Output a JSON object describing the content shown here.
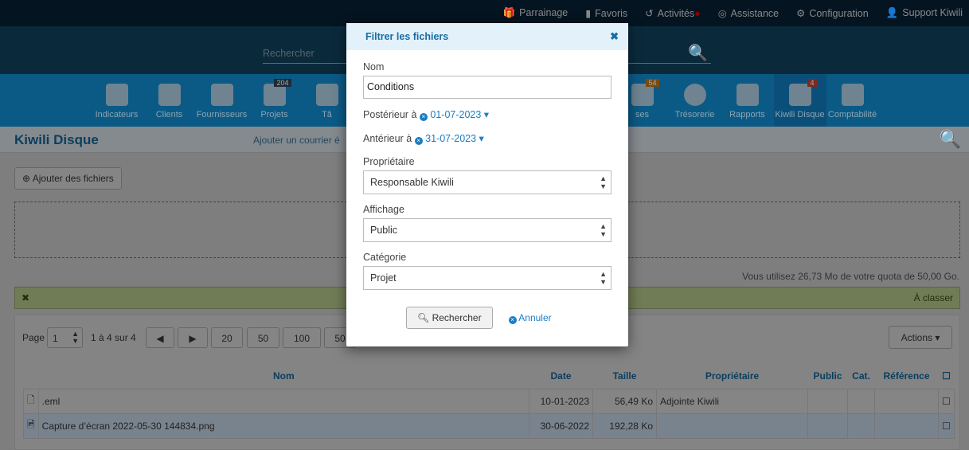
{
  "topbar": {
    "items": [
      "Parrainage",
      "Favoris",
      "Activités",
      "Assistance",
      "Configuration",
      "Support Kiwili"
    ]
  },
  "search": {
    "placeholder": "Rechercher"
  },
  "nav": {
    "items": [
      {
        "label": "Indicateurs"
      },
      {
        "label": "Clients"
      },
      {
        "label": "Fournisseurs"
      },
      {
        "label": "Projets",
        "badge": "204"
      },
      {
        "label": "Tâ"
      },
      {
        "label": "ses",
        "badge": "54"
      },
      {
        "label": "Trésorerie"
      },
      {
        "label": "Rapports"
      },
      {
        "label": "Kiwili Disque",
        "badge": "4"
      },
      {
        "label": "Comptabilité"
      }
    ]
  },
  "header": {
    "title": "Kiwili Disque",
    "add_mail": "Ajouter un courrier é"
  },
  "add_files": "Ajouter des fichiers",
  "quota": "Vous utilisez 26,73 Mo de votre quota de 50,00 Go.",
  "alert": {
    "right": "À classer"
  },
  "pager": {
    "label": "Page",
    "page": "1",
    "range": "1 à 4 sur 4",
    "sizes": [
      "20",
      "50",
      "100",
      "50"
    ],
    "actions": "Actions"
  },
  "table": {
    "columns": [
      "Nom",
      "Date",
      "Taille",
      "Propriétaire",
      "Public",
      "Cat.",
      "Référence"
    ],
    "rows": [
      {
        "name": ".eml",
        "date": "10-01-2023",
        "size": "56,49 Ko",
        "owner": "Adjointe Kiwili"
      },
      {
        "name": "Capture d’écran 2022-05-30 144834.png",
        "date": "30-06-2022",
        "size": "192,28 Ko",
        "owner": ""
      }
    ]
  },
  "modal": {
    "title": "Filtrer les fichiers",
    "name_label": "Nom",
    "name_value": "Conditions",
    "after_label": "Postérieur à",
    "after_value": "01-07-2023",
    "before_label": "Antérieur à",
    "before_value": "31-07-2023",
    "owner_label": "Propriétaire",
    "owner_value": "Responsable Kiwili",
    "display_label": "Affichage",
    "display_value": "Public",
    "category_label": "Catégorie",
    "category_value": "Projet",
    "search_btn": "Rechercher",
    "cancel_btn": "Annuler"
  }
}
